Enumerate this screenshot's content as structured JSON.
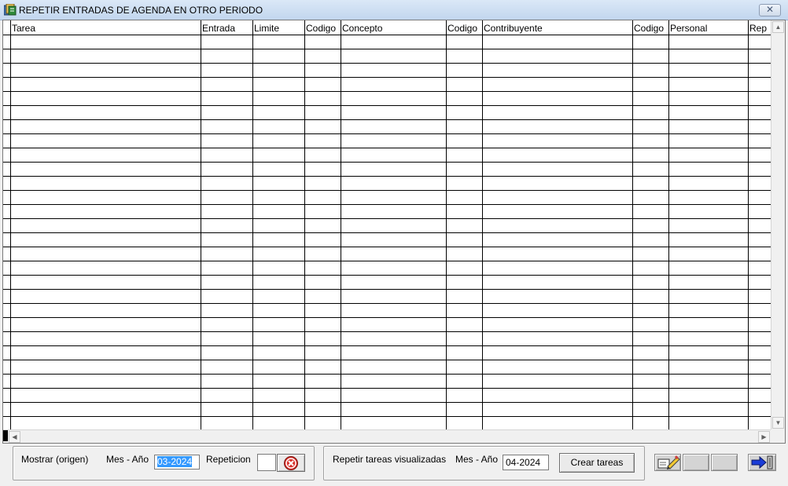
{
  "window": {
    "title": "REPETIR ENTRADAS DE AGENDA EN OTRO PERIODO",
    "close_glyph": "✕",
    "app_icon": "agenda-app-icon"
  },
  "grid": {
    "columns": [
      "Tarea",
      "Entrada",
      "Limite",
      "Codigo",
      "Concepto",
      "Codigo",
      "Contribuyente",
      "Codigo",
      "Personal",
      "Rep"
    ],
    "empty_rows": 28
  },
  "scrollbars": {
    "up_arrow": "▲",
    "down_arrow": "▼",
    "left_arrow": "◀",
    "right_arrow": "▶"
  },
  "origin_panel": {
    "mostrar_label": "Mostrar (origen)",
    "mes_anio_label": "Mes - Año",
    "mes_anio_value": "03-2024",
    "repeticion_label": "Repeticion",
    "repeticion_value": "",
    "cancel_icon": "red-x-circle-icon"
  },
  "repeat_panel": {
    "repetir_label": "Repetir tareas visualizadas",
    "mes_anio_label": "Mes - Año",
    "mes_anio_value": "04-2024",
    "crear_button": "Crear tareas"
  },
  "toolbar": {
    "edit_icon": "edit-pencil-icon",
    "exit_icon": "exit-arrow-icon"
  },
  "colors": {
    "titlebar": "#c2d6ee",
    "selection": "#3399ff",
    "cancel_red": "#d9302a",
    "exit_blue": "#1a3cd8"
  }
}
